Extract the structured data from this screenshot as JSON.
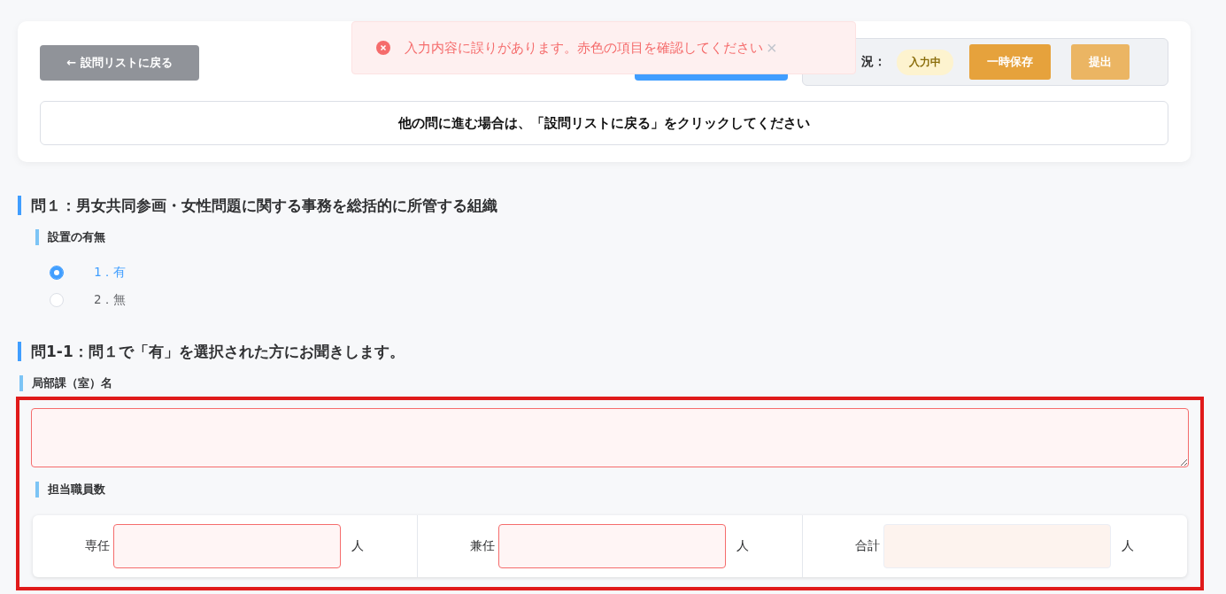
{
  "header": {
    "back_button": "← 設問リストに戻る",
    "status_label": "況：",
    "status_badge": "入力中",
    "buttons": [
      {
        "label": "一時保存",
        "disabled": false
      },
      {
        "label": "提出",
        "disabled": true
      }
    ],
    "notice": "他の問に進む場合は、「設問リストに戻る」をクリックしてください"
  },
  "toast": {
    "message": "入力内容に誤りがあります。赤色の項目を確認してください",
    "close": "×"
  },
  "questions": [
    {
      "title": "問１：男女共同参画・女性問題に関する事務を総括的に所管する組織",
      "error": false,
      "fields": [
        {
          "kind": "radio",
          "label": "設置の有無",
          "options": [
            {
              "label": "1．有",
              "selected": true
            },
            {
              "label": "2．無",
              "selected": false
            }
          ]
        }
      ]
    },
    {
      "title": "問1-1：問１で「有」を選択された方にお聞きします。",
      "error": true,
      "fields": [
        {
          "kind": "textarea",
          "label": "局部課（室）名",
          "error": true
        },
        {
          "kind": "numbers",
          "label": "担当職員数",
          "cells": [
            {
              "label": "専任",
              "unit": "人",
              "error": true,
              "readonly": false
            },
            {
              "label": "兼任",
              "unit": "人",
              "error": true,
              "readonly": false
            },
            {
              "label": "合計",
              "unit": "人",
              "error": false,
              "readonly": true
            }
          ]
        }
      ]
    }
  ]
}
